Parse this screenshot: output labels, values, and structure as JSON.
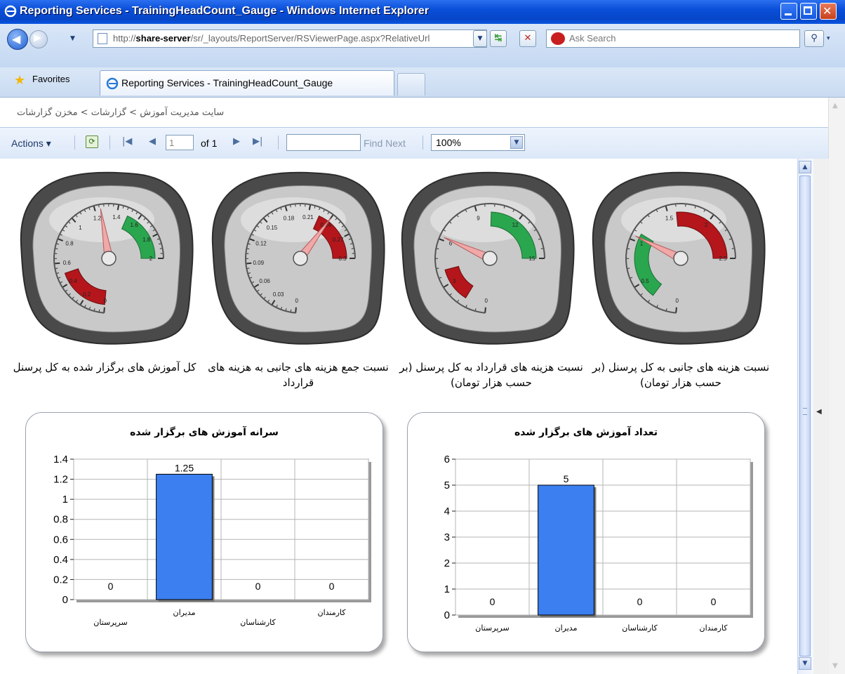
{
  "window": {
    "title": "Reporting Services - TrainingHeadCount_Gauge - Windows Internet Explorer"
  },
  "address": {
    "url_prefix": "http://",
    "url_host": "share-server",
    "url_path": "/sr/_layouts/ReportServer/RSViewerPage.aspx?RelativeUrl",
    "search_placeholder": "Ask Search"
  },
  "favorites": {
    "label": "Favorites"
  },
  "tab": {
    "label": "Reporting Services - TrainingHeadCount_Gauge"
  },
  "breadcrumb": "سایت مدیریت آموزش > گزارشات > مخزن گزارشات",
  "toolbar": {
    "actions_label": "Actions ▾",
    "page_value": "1",
    "of_label": "of 1",
    "find_next_label": "Find Next",
    "zoom_value": "100%"
  },
  "gauges": [
    {
      "caption": "کل آموزش های برگزار شده به کل پرسنل",
      "scale": [
        "0",
        "0.2",
        "0.4",
        "0.6",
        "0.8",
        "1",
        "1.2",
        "1.4",
        "1.6",
        "1.8",
        "2"
      ],
      "max": 2,
      "needle": 1.25,
      "green_range": [
        1.5,
        2
      ],
      "red_range": [
        0,
        0.5
      ]
    },
    {
      "caption": "نسبت جمع هزینه های جانبی به هزینه های قرارداد",
      "scale": [
        "0",
        "0.03",
        "0.06",
        "0.09",
        "0.12",
        "0.15",
        "0.18",
        "0.21",
        "0.24",
        "0.27",
        "0.3"
      ],
      "max": 0.3,
      "needle": 0.24,
      "green_range": null,
      "red_range": [
        0.225,
        0.3
      ]
    },
    {
      "caption": "نسبت هزینه های قرارداد به کل پرسنل (بر حسب هزار تومان)",
      "scale": [
        "0",
        "3",
        "6",
        "9",
        "12",
        "15"
      ],
      "max": 15,
      "needle": 6.2,
      "green_range": [
        10,
        15
      ],
      "red_range": [
        1.5,
        4
      ]
    },
    {
      "caption": "نسبت هزینه های جانبی به کل پرسنل (بر حسب هزار تومان)",
      "scale": [
        "0",
        "0.5",
        "1",
        "1.5",
        "2",
        "2.5"
      ],
      "max": 2.5,
      "needle": 1.05,
      "green_range": [
        0.3,
        1.1
      ],
      "red_range": [
        1.6,
        2.5
      ]
    }
  ],
  "charts": [
    {
      "title": "سرانه آموزش های برگزار شده",
      "yticks": [
        "0",
        "0.2",
        "0.4",
        "0.6",
        "0.8",
        "1",
        "1.2",
        "1.4"
      ],
      "ymax": 1.4,
      "categories": [
        "سرپرستان",
        "مدیران",
        "کارشناسان",
        "کارمندان"
      ],
      "values": [
        0,
        1.25,
        0,
        0
      ],
      "value_labels": [
        "0",
        "1.25",
        "0",
        "0"
      ]
    },
    {
      "title": "تعداد آموزش های برگزار شده",
      "yticks": [
        "0",
        "1",
        "2",
        "3",
        "4",
        "5",
        "6"
      ],
      "ymax": 6,
      "categories": [
        "سرپرستان",
        "مدیران",
        "کارشناسان",
        "کارمندان"
      ],
      "values": [
        0,
        5,
        0,
        0
      ],
      "value_labels": [
        "0",
        "5",
        "0",
        "0"
      ]
    }
  ],
  "chart_data": [
    {
      "type": "bar",
      "title": "سرانه آموزش های برگزار شده",
      "categories": [
        "سرپرستان",
        "مدیران",
        "کارشناسان",
        "کارمندان"
      ],
      "values": [
        0,
        1.25,
        0,
        0
      ],
      "ylim": [
        0,
        1.4
      ]
    },
    {
      "type": "bar",
      "title": "تعداد آموزش های برگزار شده",
      "categories": [
        "سرپرستان",
        "مدیران",
        "کارشناسان",
        "کارمندان"
      ],
      "values": [
        0,
        5,
        0,
        0
      ],
      "ylim": [
        0,
        6
      ]
    }
  ],
  "colors": {
    "bar": "#3b7ff0",
    "gauge_green": "#2aa64f",
    "gauge_red": "#b4161b",
    "needle": "#f0a8a8"
  }
}
